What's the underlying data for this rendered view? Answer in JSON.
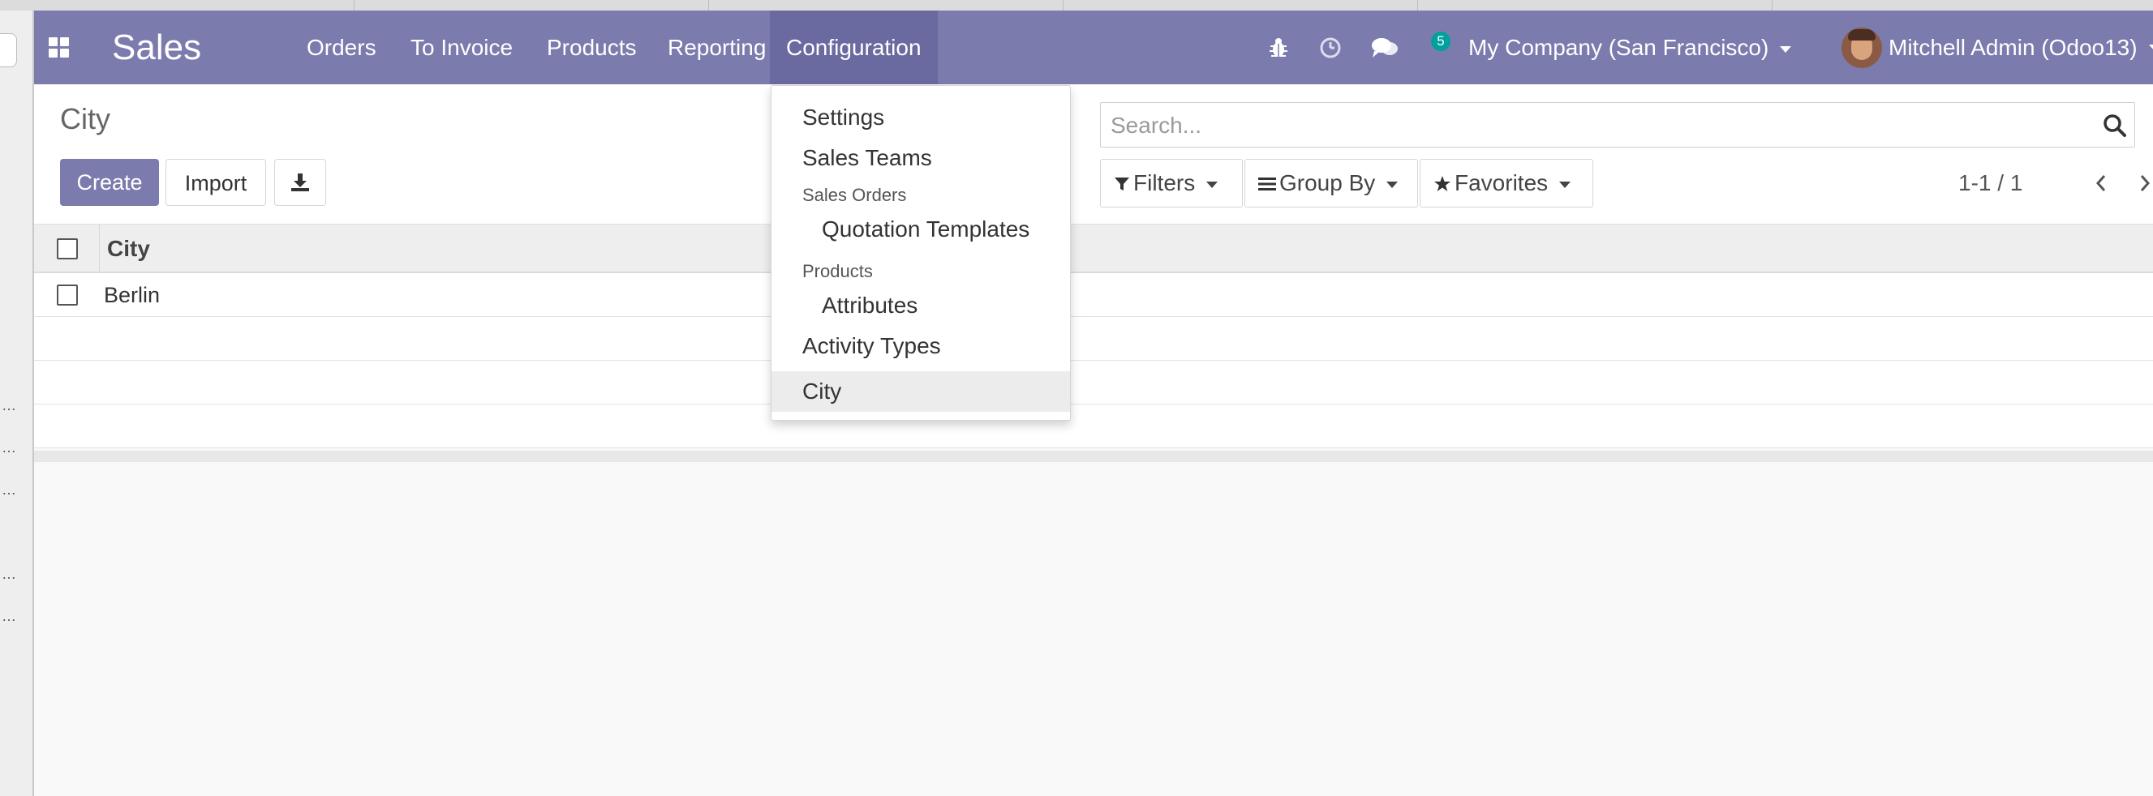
{
  "navbar": {
    "brand": "Sales",
    "menus": [
      "Orders",
      "To Invoice",
      "Products",
      "Reporting",
      "Configuration"
    ],
    "active_menu": "Configuration",
    "messages_count": "5",
    "company": "My Company (San Francisco)",
    "user": "Mitchell Admin (Odoo13)",
    "icons": [
      "apps-grid-icon",
      "bug-icon",
      "clock-icon",
      "chat-icon",
      "caret-down-icon"
    ]
  },
  "control_panel": {
    "breadcrumb": "City",
    "create_label": "Create",
    "import_label": "Import",
    "search_placeholder": "Search...",
    "filters_label": "Filters",
    "groupby_label": "Group By",
    "favorites_label": "Favorites",
    "pager": "1-1 / 1"
  },
  "list": {
    "columns": [
      "City"
    ],
    "rows": [
      [
        "Berlin"
      ]
    ]
  },
  "dropdown": {
    "settings": "Settings",
    "sales_teams": "Sales Teams",
    "sales_orders_header": "Sales Orders",
    "quotation_templates": "Quotation Templates",
    "products_header": "Products",
    "attributes": "Attributes",
    "activity_types": "Activity Types",
    "city": "City",
    "active_item": "City"
  },
  "colors": {
    "navbar": "#7c7bad",
    "navbar_active": "#6b6aa0",
    "primary_button": "#7c7bad",
    "badge": "#00a09d"
  }
}
